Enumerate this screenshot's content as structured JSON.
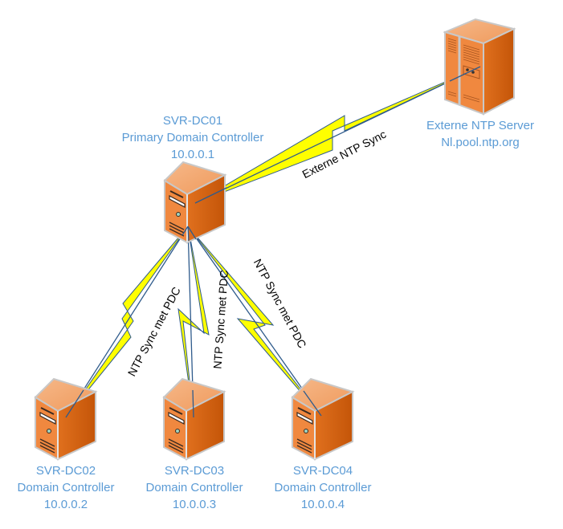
{
  "colors": {
    "label": "#5b9bd5",
    "bolt_fill": "#ffff00",
    "bolt_stroke": "#2f5b8c",
    "server_front": "#f0883f",
    "server_side": "#d5600f",
    "server_top": "#f3a570"
  },
  "nodes": {
    "dc01": {
      "icon": "server-tower-icon",
      "name": "SVR-DC01",
      "role": "Primary Domain Controller",
      "ip": "10.0.0.1"
    },
    "ntp": {
      "icon": "server-rack-icon",
      "name": "Externe NTP Server",
      "host": "Nl.pool.ntp.org"
    },
    "dc02": {
      "icon": "server-tower-icon",
      "name": "SVR-DC02",
      "role": "Domain Controller",
      "ip": "10.0.0.2"
    },
    "dc03": {
      "icon": "server-tower-icon",
      "name": "SVR-DC03",
      "role": "Domain Controller",
      "ip": "10.0.0.3"
    },
    "dc04": {
      "icon": "server-tower-icon",
      "name": "SVR-DC04",
      "role": "Domain Controller",
      "ip": "10.0.0.4"
    }
  },
  "links": {
    "external": "Externe NTP Sync",
    "dc02": "NTP Sync met PDC",
    "dc03": "NTP Sync met PDC",
    "dc04": "NTP Sync met PDC"
  }
}
